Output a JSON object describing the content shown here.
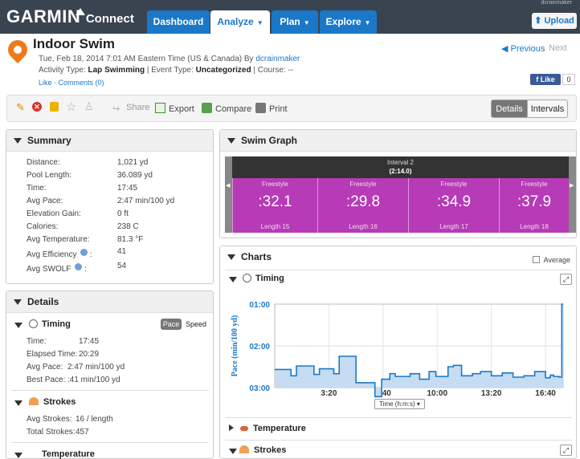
{
  "nav": {
    "brand": "GARMIN",
    "product": "Connect",
    "tabs": [
      {
        "label": "Dashboard",
        "caret": ""
      },
      {
        "label": "Analyze",
        "caret": "▼"
      },
      {
        "label": "Plan",
        "caret": "▼"
      },
      {
        "label": "Explore",
        "caret": "▼"
      }
    ],
    "upload_label": "Upload",
    "user_text": "dcrainmaker"
  },
  "activity": {
    "title": "Indoor Swim",
    "date": "Tue, Feb 18, 2014 7:01 AM Eastern Time (US & Canada) By",
    "author": "dcrainmaker",
    "type_label": "Activity Type:",
    "type_value": "Lap Swimming",
    "event_label": "| Event Type:",
    "event_value": "Uncategorized",
    "course_text": "| Course: --",
    "like_link": "Like",
    "comments_link": "Comments (0)",
    "prev_label": "Previous",
    "next_label": "Next",
    "fb_like": "Like",
    "fb_count": "0"
  },
  "toolbar": {
    "share": "Share",
    "export": "Export",
    "compare": "Compare",
    "print": "Print",
    "details": "Details",
    "intervals": "Intervals"
  },
  "summary": {
    "heading": "Summary",
    "rows": [
      {
        "label": "Distance:",
        "value": "1,021 yd"
      },
      {
        "label": "Pool Length:",
        "value": "36.089 yd"
      },
      {
        "label": "Time:",
        "value": "17:45"
      },
      {
        "label": "Avg Pace:",
        "value": "2:47 min/100 yd"
      },
      {
        "label": "Elevation Gain:",
        "value": "0 ft"
      },
      {
        "label": "Calories:",
        "value": "238 C"
      },
      {
        "label": "Avg Temperature:",
        "value": "81.3 °F"
      },
      {
        "label": "Avg Efficiency",
        "value": "41"
      },
      {
        "label": "Avg SWOLF",
        "value": "54"
      }
    ]
  },
  "details": {
    "heading": "Details",
    "timing_heading": "Timing",
    "pace_pill": "Pace",
    "speed_pill": "Speed",
    "timing_rows": [
      {
        "label": "Time:",
        "value": "17:45"
      },
      {
        "label": "Elapsed Time:",
        "value": "20:29"
      },
      {
        "label": "Avg Pace:",
        "value": "2:47 min/100 yd"
      },
      {
        "label": "Best Pace:",
        "value": ":41 min/100 yd"
      }
    ],
    "strokes_heading": "Strokes",
    "stroke_rows": [
      {
        "label": "Avg Strokes:",
        "value": "16 / length"
      },
      {
        "label": "Total Strokes:",
        "value": "457"
      }
    ],
    "temperature_heading": "Temperature"
  },
  "swim_graph": {
    "heading": "Swim Graph",
    "interval_title": "Interval 2",
    "interval_time": "(2:14.0)",
    "lengths": [
      {
        "stroke": "Freestyle",
        "time": ":32.1",
        "length": "Length 15"
      },
      {
        "stroke": "Freestyle",
        "time": ":29.8",
        "length": "Length 16"
      },
      {
        "stroke": "Freestyle",
        "time": ":34.9",
        "length": "Length 17"
      },
      {
        "stroke": "Freestyle",
        "time": ":37.9",
        "length": "Length 18"
      }
    ]
  },
  "charts": {
    "heading": "Charts",
    "average_label": "Average",
    "timing_label": "Timing",
    "temperature_label": "Temperature",
    "strokes_label": "Strokes",
    "axis_select": "Time (h:m:s)"
  },
  "chart_data": {
    "type": "area",
    "title": "",
    "ylabel": "Pace (min/100 yd)",
    "xlabel": "",
    "x_ticks": [
      "3:20",
      "6:40",
      "10:00",
      "13:20",
      "16:40"
    ],
    "x_tick_seconds": [
      200,
      400,
      600,
      800,
      1000
    ],
    "xlim": [
      0,
      1065
    ],
    "y_ticks": [
      "01:00",
      "02:00",
      "03:00"
    ],
    "ylim_seconds": [
      60,
      180
    ],
    "y_inverted": true,
    "color": "#1b78c8",
    "fill": "#c5dcf3",
    "series": [
      {
        "x": [
          0,
          60,
          80,
          145,
          165,
          218,
          238,
          300,
          370,
          395,
          425,
          445,
          500,
          535,
          570,
          595,
          640,
          660,
          690,
          730,
          760,
          800,
          840,
          880,
          920,
          960,
          1000,
          1015,
          1018,
          1030,
          1050,
          1060
        ],
        "y": [
          154,
          163,
          149,
          161,
          153,
          160,
          135,
          173,
          193,
          168,
          160,
          164,
          160,
          168,
          157,
          164,
          150,
          148,
          163,
          160,
          157,
          163,
          159,
          165,
          163,
          157,
          166,
          165,
          162,
          164,
          165,
          60
        ]
      }
    ]
  }
}
